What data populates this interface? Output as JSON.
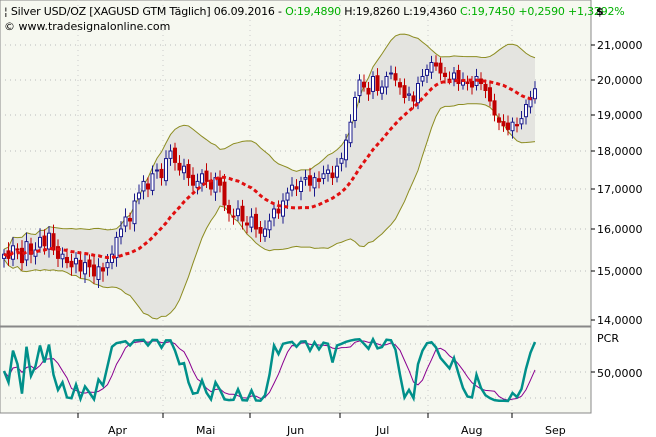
{
  "header": {
    "symbol": "Silver USD/OZ [XAGUSD GTM  Täglich] 06.09.2016 -",
    "open": "O:19,4890",
    "high": "H:19,8260",
    "low": "L:19,4360",
    "close": "C:19,7450",
    "change": "+0,2590",
    "pct": "+1,3292%",
    "copyright": "© www.tradesignalonline.com",
    "currency": "$"
  },
  "colors": {
    "up": "#1a1a8c",
    "down": "#c00000",
    "band": "#e4e4e0",
    "band_line": "#8c8c20",
    "sma": "#e01010",
    "pcr": "#00908a",
    "signal": "#8a0090",
    "bg": "#f6f8f0"
  },
  "chart_data": {
    "type": "candlestick",
    "y_ticks": [
      "21,0000",
      "20,0000",
      "19,0000",
      "18,0000",
      "17,0000",
      "16,0000",
      "15,0000",
      "14,0000"
    ],
    "y_values": [
      21,
      20,
      19,
      18,
      17,
      16,
      15,
      14
    ],
    "x_labels": [
      "Apr",
      "Mai",
      "Jun",
      "Jul",
      "Aug",
      "Sep"
    ],
    "indicator": {
      "name": "PCR",
      "tick": "50,0000"
    },
    "closes": [
      15.4,
      15.3,
      15.6,
      15.5,
      15.2,
      15.7,
      15.4,
      15.5,
      15.8,
      15.6,
      15.9,
      15.5,
      15.3,
      15.4,
      15.2,
      15.1,
      15.3,
      15.0,
      15.2,
      15.1,
      14.9,
      15.1,
      15.0,
      15.2,
      15.4,
      15.8,
      16.0,
      16.3,
      16.2,
      16.7,
      16.9,
      17.2,
      17.0,
      17.4,
      17.5,
      17.3,
      17.8,
      18.0,
      17.7,
      17.5,
      17.6,
      17.3,
      17.1,
      17.2,
      17.4,
      17.2,
      17.0,
      17.3,
      17.1,
      16.6,
      16.4,
      16.3,
      16.5,
      16.2,
      16.1,
      16.3,
      16.0,
      15.9,
      16.0,
      16.2,
      16.5,
      16.4,
      16.7,
      16.9,
      17.1,
      17.0,
      17.2,
      17.3,
      17.1,
      17.3,
      17.2,
      17.4,
      17.5,
      17.3,
      17.6,
      17.8,
      18.3,
      18.8,
      19.5,
      20.0,
      19.8,
      19.6,
      20.1,
      19.7,
      19.8,
      20.1,
      20.2,
      20.0,
      19.8,
      19.5,
      19.6,
      19.4,
      19.9,
      20.1,
      20.3,
      20.5,
      20.4,
      20.2,
      20.1,
      20.0,
      20.2,
      19.9,
      20.0,
      19.9,
      19.8,
      20.1,
      19.9,
      19.7,
      19.4,
      19.0,
      18.8,
      18.7,
      18.6,
      18.8,
      18.7,
      18.9,
      19.3,
      19.5,
      19.75
    ]
  }
}
